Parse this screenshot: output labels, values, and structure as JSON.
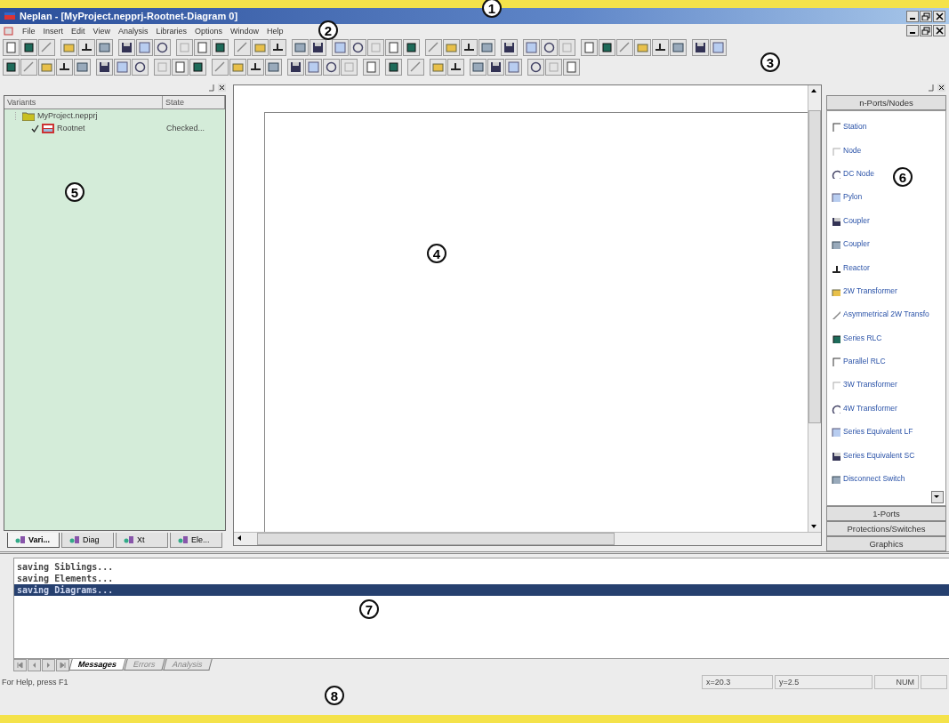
{
  "window": {
    "title": "Neplan - [MyProject.nepprj-Rootnet-Diagram 0]"
  },
  "menu": [
    "File",
    "Insert",
    "Edit",
    "View",
    "Analysis",
    "Libraries",
    "Options",
    "Window",
    "Help"
  ],
  "variants_panel": {
    "columns": [
      "Variants",
      "State"
    ],
    "tree": [
      {
        "label": "MyProject.nepprj",
        "expanded": true,
        "children": [
          {
            "label": "Rootnet",
            "checked": true,
            "state": "Checked..."
          }
        ]
      }
    ],
    "tabs": [
      {
        "label": "Vari...",
        "selected": true
      },
      {
        "label": "Diag",
        "selected": false
      },
      {
        "label": "Xt",
        "selected": false
      },
      {
        "label": "Ele...",
        "selected": false
      }
    ]
  },
  "symbol_panel": {
    "header": "n-Ports/Nodes",
    "items": [
      "Station",
      "Node",
      "DC Node",
      "Pylon",
      "Coupler",
      "Coupler",
      "Reactor",
      "2W Transformer",
      "Asymmetrical 2W Transfo",
      "Series RLC",
      "Parallel RLC",
      "3W Transformer",
      "4W Transformer",
      "Series Equivalent LF",
      "Series Equivalent SC",
      "Disconnect Switch"
    ],
    "sections": [
      "1-Ports",
      "Protections/Switches",
      "Graphics"
    ]
  },
  "messages": {
    "lines": [
      {
        "text": "saving Siblings...",
        "selected": false
      },
      {
        "text": "saving Elements...",
        "selected": false
      },
      {
        "text": "saving Diagrams...",
        "selected": true
      }
    ],
    "tabs": [
      {
        "label": "Messages",
        "selected": true
      },
      {
        "label": "Errors",
        "selected": false
      },
      {
        "label": "Analysis",
        "selected": false
      }
    ]
  },
  "status_bar": {
    "help": "For Help, press F1",
    "x": "x=20.3",
    "y": "y=2.5",
    "num": "NUM"
  },
  "callouts": [
    "1",
    "2",
    "3",
    "4",
    "5",
    "6",
    "7",
    "8"
  ]
}
